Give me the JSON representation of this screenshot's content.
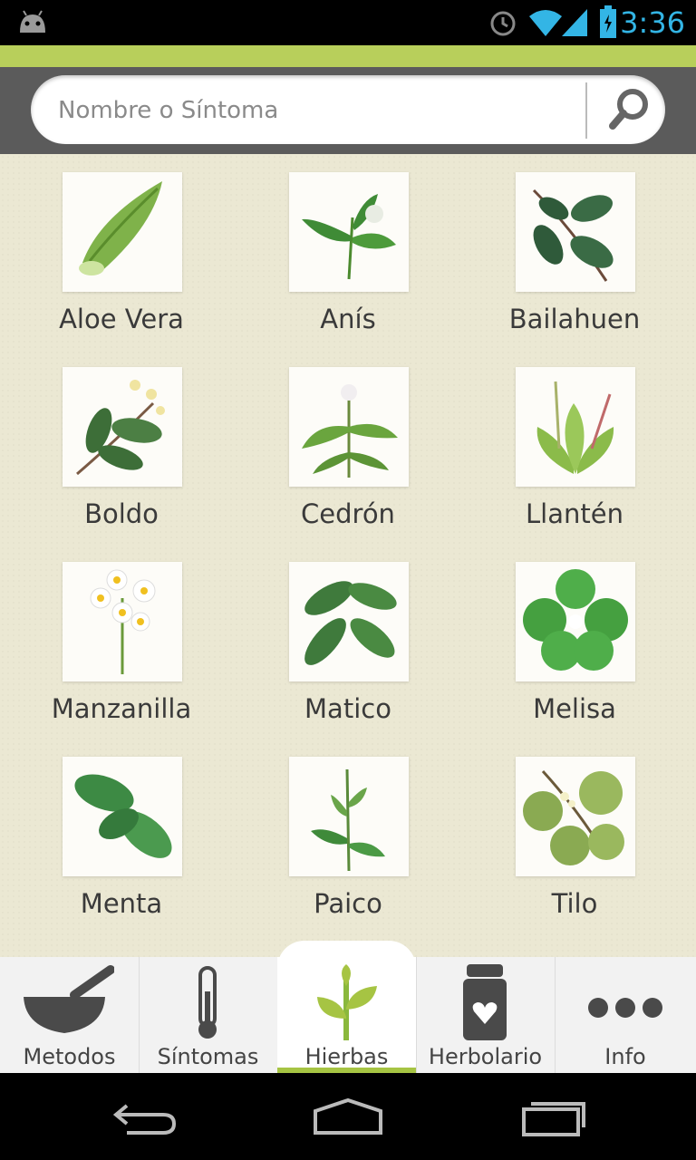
{
  "status": {
    "time": "3:36"
  },
  "search": {
    "placeholder": "Nombre o Síntoma"
  },
  "herbs": [
    {
      "name": "Aloe Vera",
      "icon": "aloe-vera-icon"
    },
    {
      "name": "Anís",
      "icon": "anis-icon"
    },
    {
      "name": "Bailahuen",
      "icon": "bailahuen-icon"
    },
    {
      "name": "Boldo",
      "icon": "boldo-icon"
    },
    {
      "name": "Cedrón",
      "icon": "cedron-icon"
    },
    {
      "name": "Llantén",
      "icon": "llanten-icon"
    },
    {
      "name": "Manzanilla",
      "icon": "manzanilla-icon"
    },
    {
      "name": "Matico",
      "icon": "matico-icon"
    },
    {
      "name": "Melisa",
      "icon": "melisa-icon"
    },
    {
      "name": "Menta",
      "icon": "menta-icon"
    },
    {
      "name": "Paico",
      "icon": "paico-icon"
    },
    {
      "name": "Tilo",
      "icon": "tilo-icon"
    }
  ],
  "tabs": [
    {
      "label": "Metodos",
      "icon": "mortar-pestle-icon"
    },
    {
      "label": "Síntomas",
      "icon": "thermometer-icon"
    },
    {
      "label": "Hierbas",
      "icon": "sprout-icon",
      "active": true
    },
    {
      "label": "Herbolario",
      "icon": "jar-heart-icon"
    },
    {
      "label": "Info",
      "icon": "more-dots-icon"
    }
  ],
  "colors": {
    "accent": "#b8cf5b",
    "active_tab": "#a6c443",
    "background": "#ebe8d3",
    "status_icons": "#33b5e5"
  }
}
